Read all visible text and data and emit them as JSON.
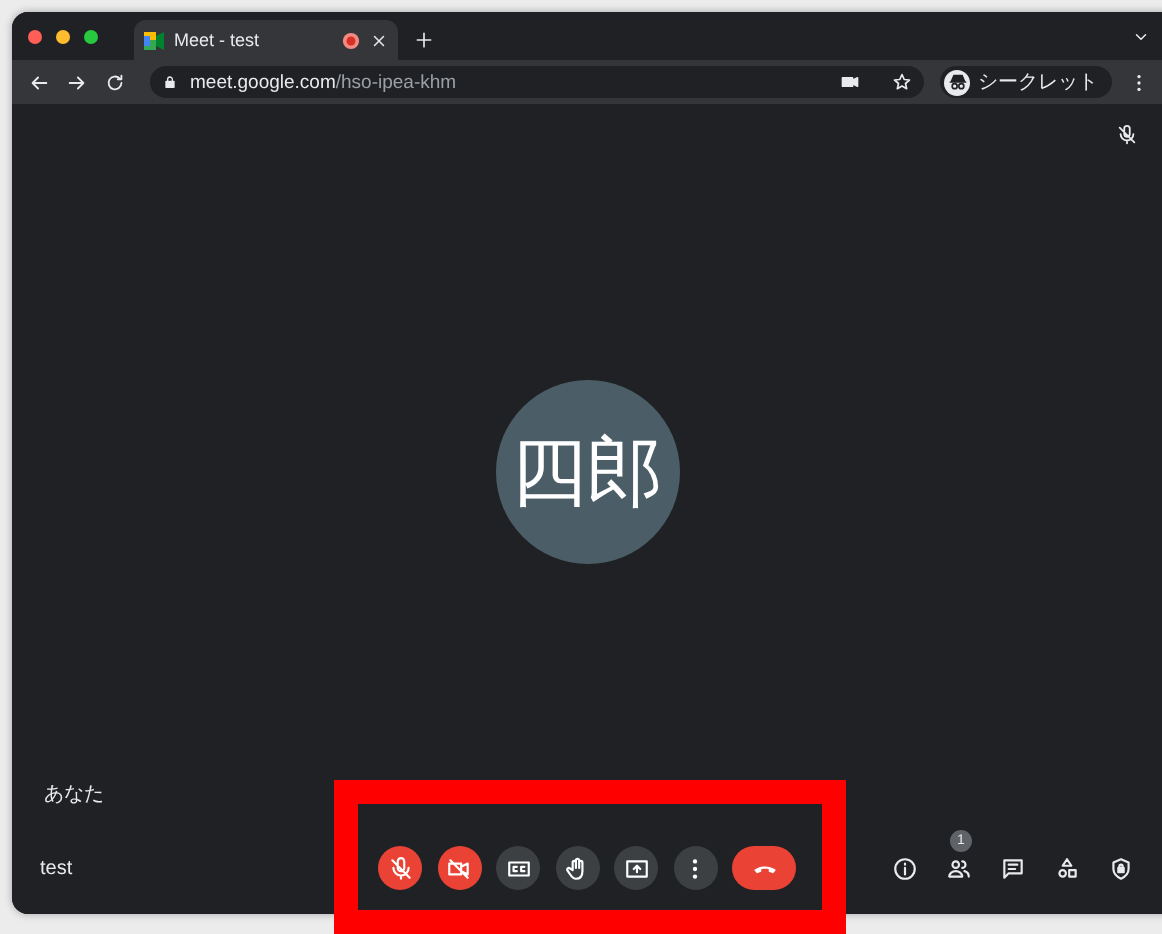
{
  "window": {
    "tabs": [
      {
        "title": "Meet - test",
        "selected": true,
        "recording": true
      }
    ]
  },
  "toolbar": {
    "url_host": "meet.google.com",
    "url_path": "/hso-ipea-khm",
    "profile": "シークレット"
  },
  "meeting": {
    "participant": {
      "initials": "四郎",
      "self_label": "あなた",
      "muted": true
    },
    "meeting_name": "test",
    "controls": [
      {
        "kind": "mic",
        "on": false
      },
      {
        "kind": "camera",
        "on": false
      },
      {
        "kind": "captions"
      },
      {
        "kind": "hand"
      },
      {
        "kind": "present"
      },
      {
        "kind": "more"
      },
      {
        "kind": "leave"
      }
    ],
    "side_buttons": [
      {
        "kind": "info"
      },
      {
        "kind": "people",
        "badge": "1"
      },
      {
        "kind": "chat"
      },
      {
        "kind": "activities"
      },
      {
        "kind": "host"
      }
    ]
  },
  "highlight": {
    "visible": true
  }
}
